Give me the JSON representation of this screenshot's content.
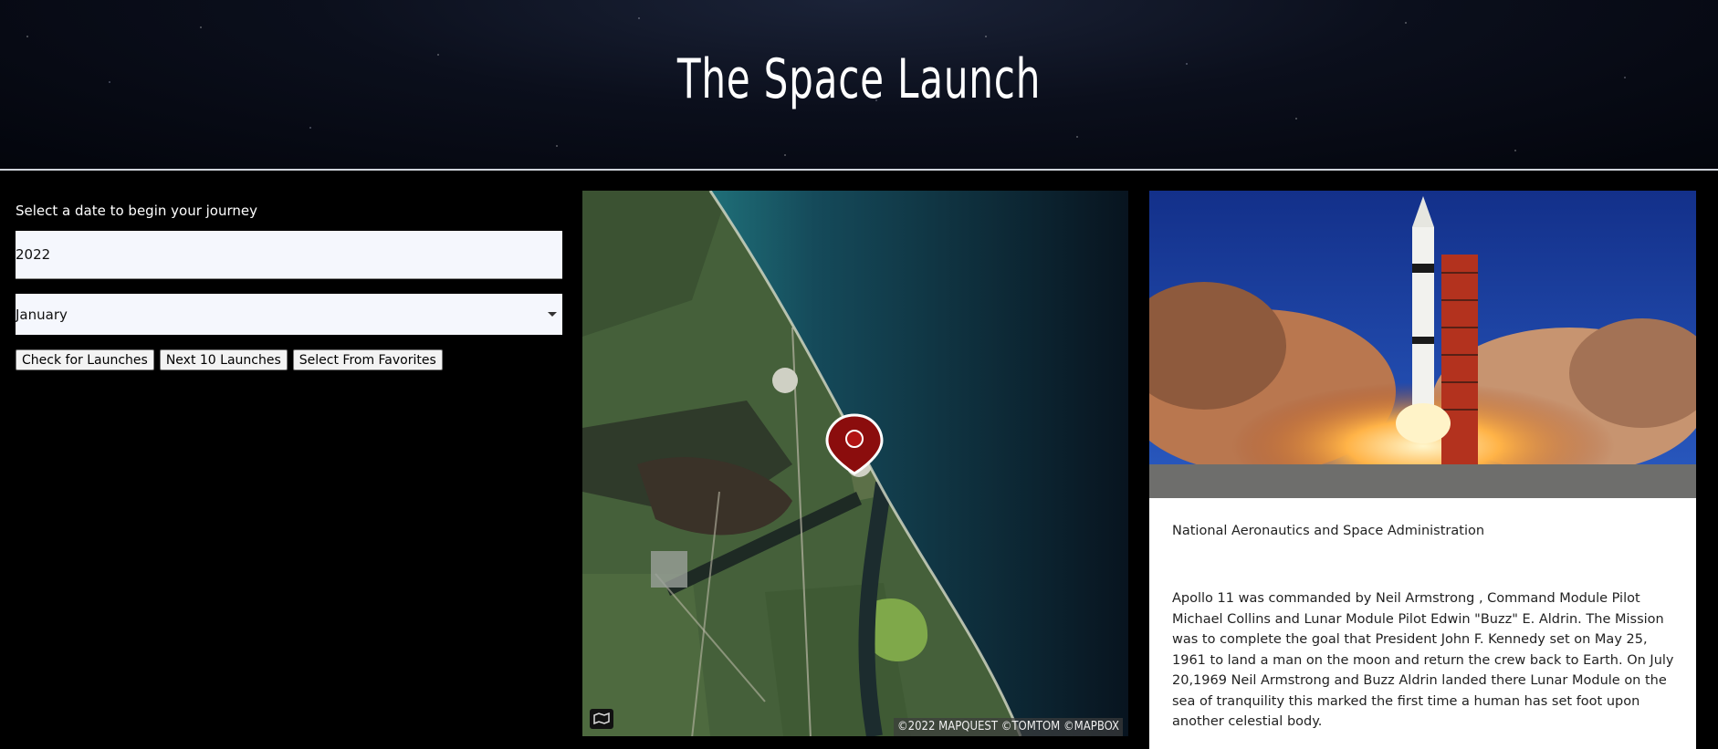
{
  "header": {
    "title": "The Space Launch"
  },
  "controls": {
    "prompt": "Select a date to begin your journey",
    "year_value": "2022",
    "month_value": "January",
    "buttons": {
      "check": "Check for Launches",
      "next10": "Next 10 Launches",
      "favorites": "Select From Favorites"
    }
  },
  "map": {
    "attribution": "©2022 MAPQUEST ©TOMTOM ©MAPBOX",
    "marker_color": "#8b0d0d"
  },
  "info": {
    "agency": "National Aeronautics and Space Administration",
    "description": "Apollo 11 was commanded by Neil Armstrong , Command Module Pilot Michael Collins and Lunar Module Pilot Edwin \"Buzz\" E. Aldrin. The Mission was to complete the goal that President John F. Kennedy set on May 25, 1961 to land a man on the moon and return the crew back to Earth. On July 20,1969 Neil Armstrong and Buzz Aldrin landed there Lunar Module on the sea of tranquility this marked the first time a human has set foot upon another celestial body."
  }
}
